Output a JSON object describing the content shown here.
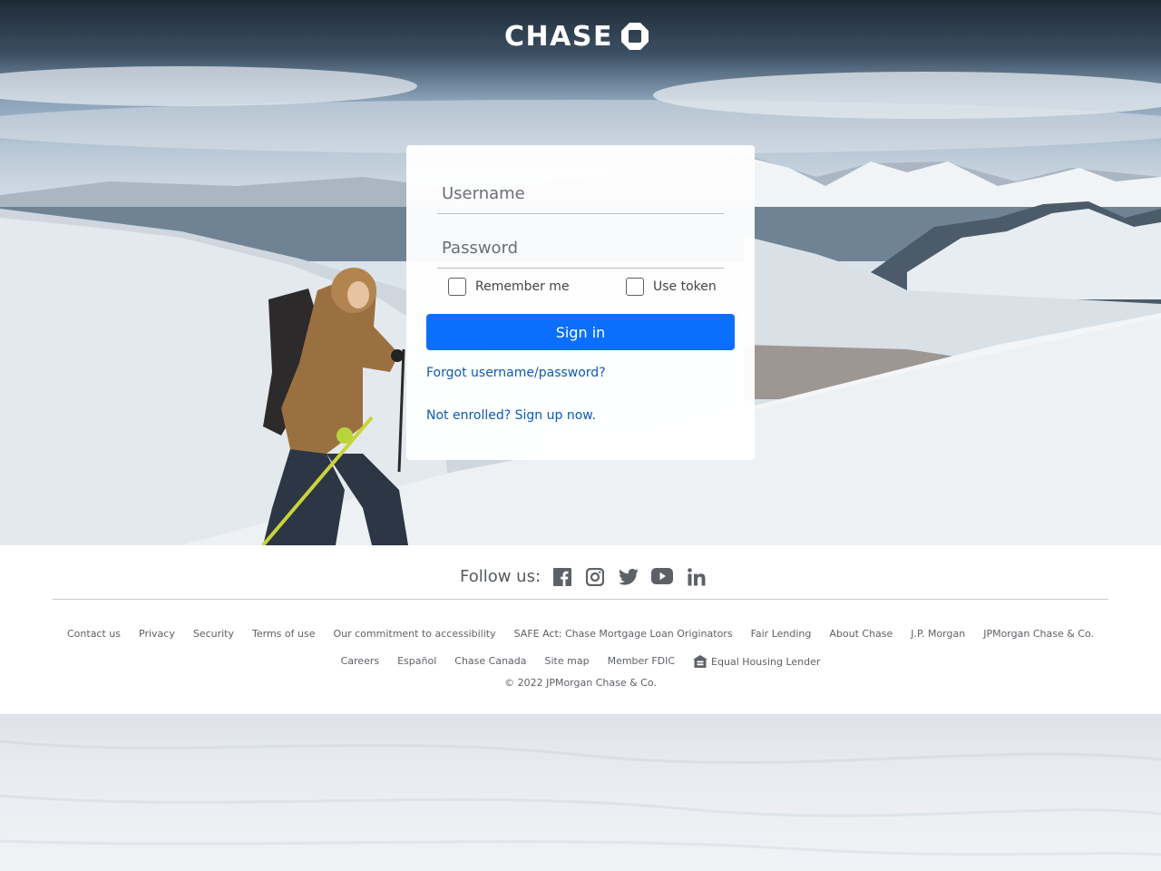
{
  "brand": {
    "name": "CHASE"
  },
  "login": {
    "username_placeholder": "Username",
    "password_placeholder": "Password",
    "remember_label": "Remember me",
    "token_label": "Use token",
    "signin_label": "Sign in",
    "forgot_link": "Forgot username/password?",
    "enroll_link": "Not enrolled? Sign up now."
  },
  "footer": {
    "follow_label": "Follow us:",
    "social": [
      "facebook-icon",
      "instagram-icon",
      "twitter-icon",
      "youtube-icon",
      "linkedin-icon"
    ],
    "links_row1": [
      "Contact us",
      "Privacy",
      "Security",
      "Terms of use",
      "Our commitment to accessibility",
      "SAFE Act: Chase Mortgage Loan Originators",
      "Fair Lending",
      "About Chase",
      "J.P. Morgan",
      "JPMorgan Chase & Co."
    ],
    "links_row2": [
      "Careers",
      "Español",
      "Chase Canada",
      "Site map",
      "Member FDIC",
      "Equal Housing Lender"
    ],
    "copyright": "© 2022 JPMorgan Chase & Co."
  },
  "colors": {
    "primary_button": "#0b6efd",
    "link": "#0b5ab4"
  }
}
